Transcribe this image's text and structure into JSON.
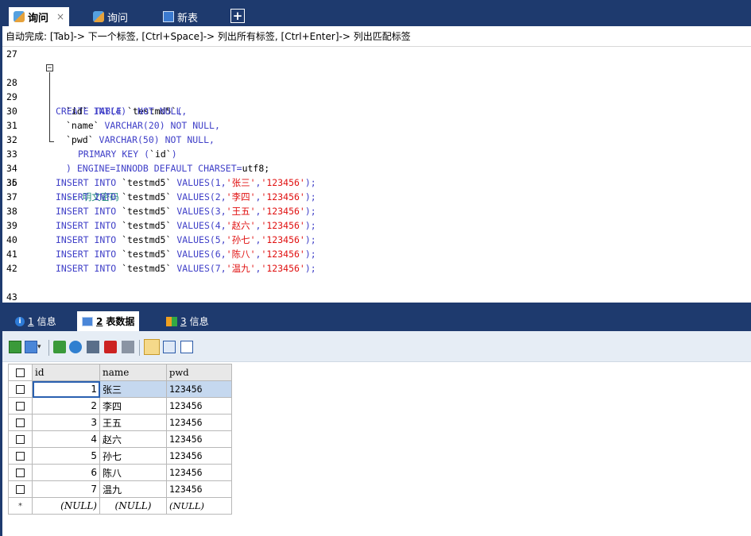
{
  "tabs": [
    {
      "label": "询问",
      "active": true,
      "close": "×"
    },
    {
      "label": "询问",
      "active": false
    },
    {
      "label": "新表",
      "active": false
    }
  ],
  "add_tab": "+",
  "hint": "自动完成: [Tab]-> 下一个标签, [Ctrl+Space]-> 列出所有标签, [Ctrl+Enter]-> 列出匹配标签",
  "editor": {
    "line_numbers": [
      "27",
      "28",
      "29",
      "30",
      "31",
      "32",
      "33",
      "34",
      "35",
      "36",
      "37",
      "38",
      "39",
      "40",
      "41",
      "42",
      "43"
    ],
    "fold_marker": "−",
    "code": {
      "l28": [
        "CREATE TABLE ",
        "`testmd5`",
        "("
      ],
      "l29": [
        "`id`",
        " INT(4)  NOT NULL,"
      ],
      "l30": [
        "`name`",
        " VARCHAR(20) NOT NULL,"
      ],
      "l31": [
        "`pwd`",
        " VARCHAR(50) NOT NULL,"
      ],
      "l32": [
        "PRIMARY KEY (",
        "`id`",
        ")"
      ],
      "l33": [
        ") ENGINE=INNODB DEFAULT CHARSET=",
        "utf8;"
      ],
      "l35": "-- 明文密码",
      "inserts": [
        {
          "prefix": "INSERT INTO ",
          "table": "`testmd5`",
          "mid": " VALUES(1,",
          "name": "'张三'",
          "sep": ",",
          "pwd": "'123456'",
          "end": ");"
        },
        {
          "prefix": "INSERT INTO ",
          "table": "`testmd5`",
          "mid": " VALUES(2,",
          "name": "'李四'",
          "sep": ",",
          "pwd": "'123456'",
          "end": ");"
        },
        {
          "prefix": "INSERT INTO ",
          "table": "`testmd5`",
          "mid": " VALUES(3,",
          "name": "'王五'",
          "sep": ",",
          "pwd": "'123456'",
          "end": ");"
        },
        {
          "prefix": "INSERT INTO ",
          "table": "`testmd5`",
          "mid": " VALUES(4,",
          "name": "'赵六'",
          "sep": ",",
          "pwd": "'123456'",
          "end": ");"
        },
        {
          "prefix": "INSERT INTO ",
          "table": "`testmd5`",
          "mid": " VALUES(5,",
          "name": "'孙七'",
          "sep": ",",
          "pwd": "'123456'",
          "end": ");"
        },
        {
          "prefix": "INSERT INTO ",
          "table": "`testmd5`",
          "mid": " VALUES(6,",
          "name": "'陈八'",
          "sep": ",",
          "pwd": "'123456'",
          "end": ");"
        },
        {
          "prefix": "INSERT INTO ",
          "table": "`testmd5`",
          "mid": " VALUES(7,",
          "name": "'温九'",
          "sep": ",",
          "pwd": "'123456'",
          "end": ");"
        }
      ]
    }
  },
  "result_tabs": [
    {
      "num": "1",
      "label": "信息",
      "active": false
    },
    {
      "num": "2",
      "label": "表数据",
      "active": true
    },
    {
      "num": "3",
      "label": "信息",
      "active": false
    }
  ],
  "grid": {
    "columns": [
      "id",
      "name",
      "pwd"
    ],
    "rows": [
      {
        "id": "1",
        "name": "张三",
        "pwd": "123456"
      },
      {
        "id": "2",
        "name": "李四",
        "pwd": "123456"
      },
      {
        "id": "3",
        "name": "王五",
        "pwd": "123456"
      },
      {
        "id": "4",
        "name": "赵六",
        "pwd": "123456"
      },
      {
        "id": "5",
        "name": "孙七",
        "pwd": "123456"
      },
      {
        "id": "6",
        "name": "陈八",
        "pwd": "123456"
      },
      {
        "id": "7",
        "name": "温九",
        "pwd": "123456"
      }
    ],
    "new_row_marker": "*",
    "null_text": "(NULL)"
  },
  "colors": {
    "tab_bar": "#1e3a6e",
    "keyword": "#4040c8",
    "string": "#e01010",
    "comment": "#1a8a78",
    "selection": "#c5d8ef"
  }
}
